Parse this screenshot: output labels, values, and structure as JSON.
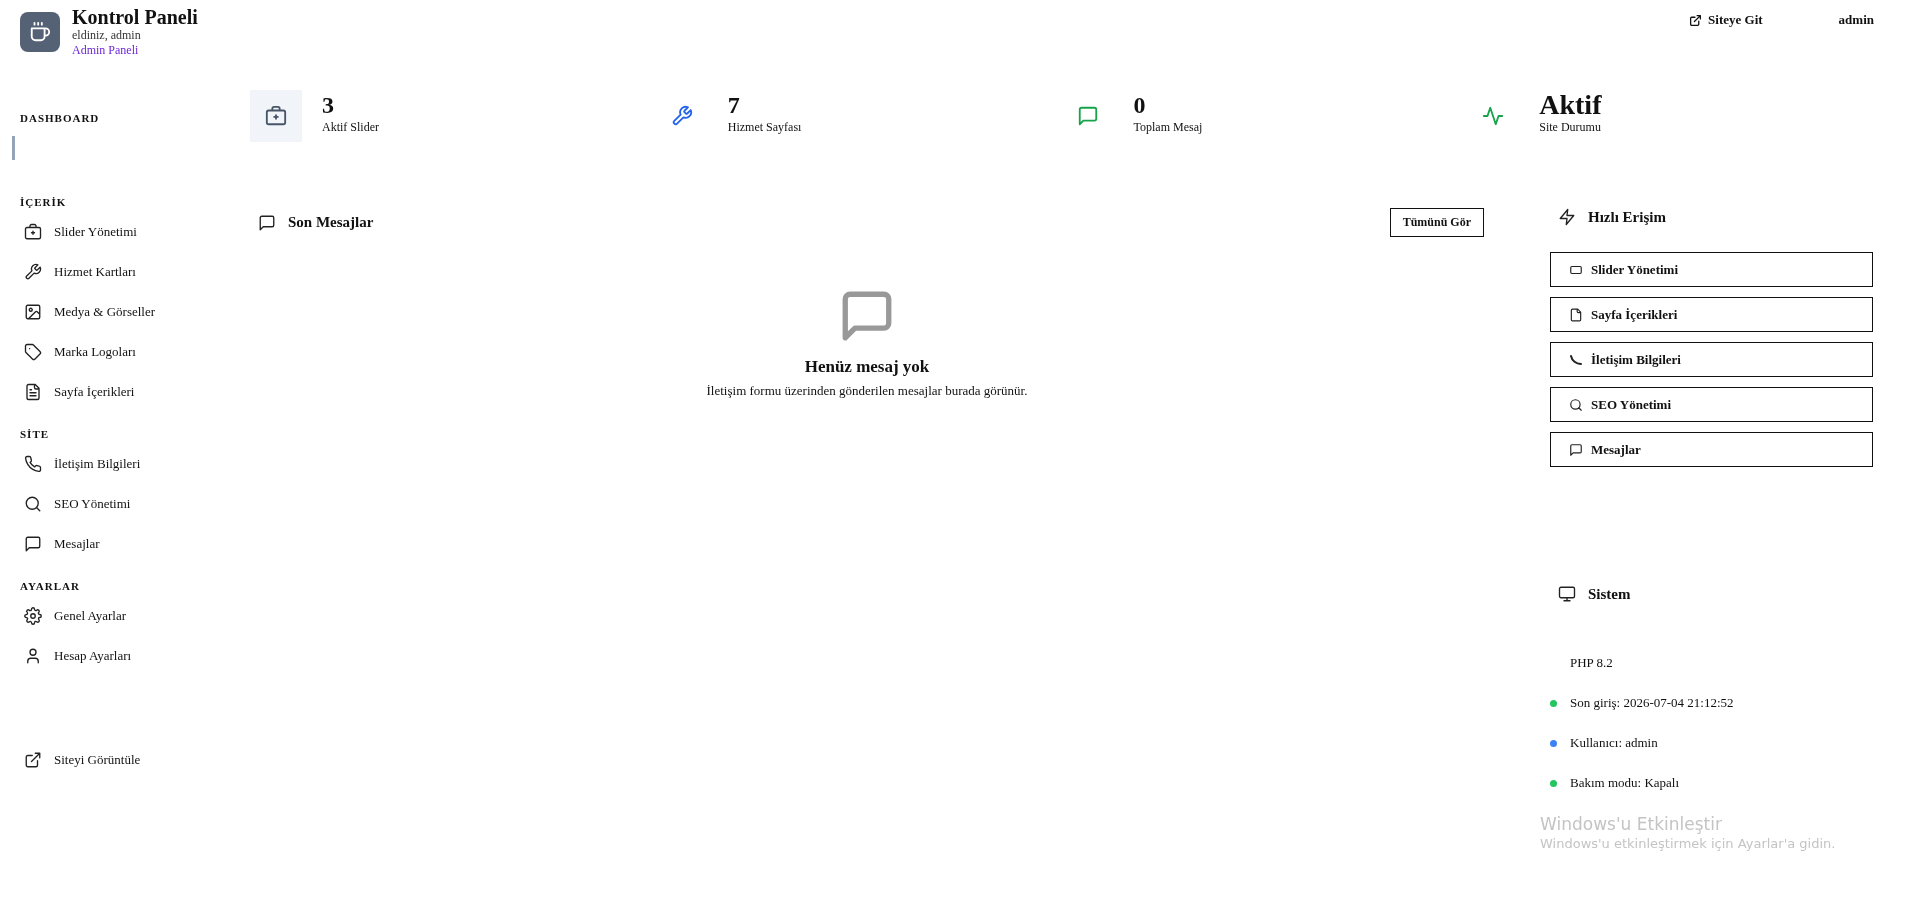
{
  "header": {
    "title": "Kontrol Paneli",
    "welcome": "eldiniz, admin",
    "subtitle": "Admin Paneli",
    "links": [
      {
        "label": "Siteye Git",
        "kind": "external"
      },
      {
        "label": "admin",
        "kind": "user"
      }
    ]
  },
  "sidebar": {
    "sections": [
      {
        "title": "DASHBOARD"
      },
      {
        "title": "İÇERİK",
        "items": [
          {
            "label": "Slider Yönetimi"
          },
          {
            "label": "Hizmet Kartları"
          },
          {
            "label": "Medya & Görseller"
          },
          {
            "label": "Marka Logoları"
          },
          {
            "label": "Sayfa İçerikleri"
          }
        ]
      },
      {
        "title": "SİTE",
        "items": [
          {
            "label": "İletişim Bilgileri"
          },
          {
            "label": "SEO Yönetimi"
          },
          {
            "label": "Mesajlar"
          }
        ]
      },
      {
        "title": "AYARLAR",
        "items": [
          {
            "label": "Genel Ayarlar"
          },
          {
            "label": "Hesap Ayarları"
          }
        ]
      }
    ],
    "footer_link": "Siteyi Görüntüle"
  },
  "stats": [
    {
      "value": "3",
      "label": "Aktif Slider",
      "color": "#475569"
    },
    {
      "value": "7",
      "label": "Hizmet Sayfası",
      "color": "#2563eb"
    },
    {
      "value": "0",
      "label": "Toplam Mesaj",
      "color": "#16a34a"
    },
    {
      "value": "Aktif",
      "label": "Site Durumu",
      "color": "#16a34a"
    }
  ],
  "messages": {
    "title": "Son Mesajlar",
    "button": "Tümünü Gör",
    "empty_title": "Henüz mesaj yok",
    "empty_text": "İletişim formu üzerinden gönderilen mesajlar burada görünür."
  },
  "quick_access": {
    "title": "Hızlı Erişim",
    "buttons": [
      "Slider Yönetimi",
      "Sayfa İçerikleri",
      "İletişim Bilgileri",
      "SEO Yönetimi",
      "Mesajlar"
    ]
  },
  "system": {
    "title": "Sistem",
    "items": [
      {
        "text": "PHP 8.2"
      },
      {
        "text": "Son giriş: 2026-07-04 21:12:52",
        "color": "#22c55e"
      },
      {
        "text": "Kullanıcı: admin",
        "color": "#3b82f6"
      },
      {
        "text": "Bakım modu: Kapalı",
        "color": "#22c55e"
      }
    ]
  },
  "os_notice": {
    "title": "Windows'u Etkinleştir",
    "text": "Windows'u etkinleştirmek için Ayarlar'a gidin."
  }
}
